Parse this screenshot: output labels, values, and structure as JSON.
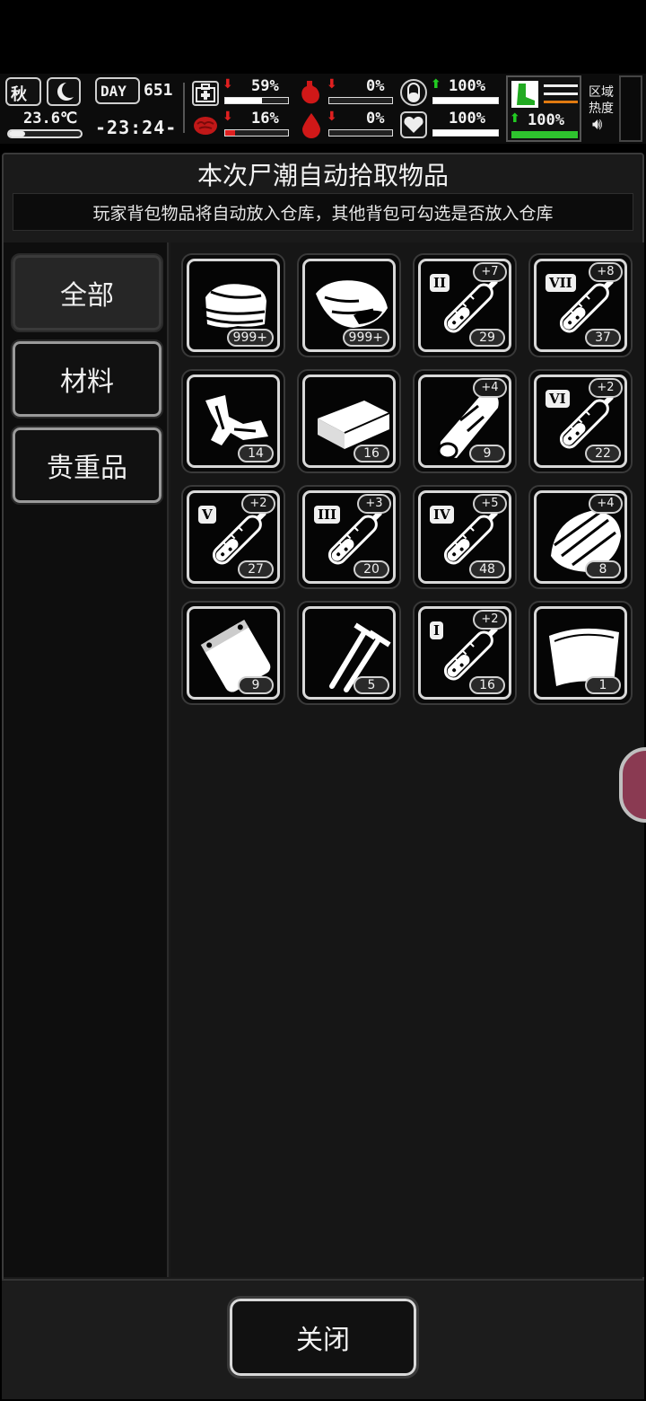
{
  "status": {
    "season": "秋",
    "temperature": "23.6℃",
    "day_label": "DAY",
    "day_number": "651",
    "time": "-23:24-",
    "stats": [
      {
        "name": "health",
        "value": "59%",
        "trend": "down",
        "level": 0.59,
        "color": "#ffffff"
      },
      {
        "name": "hunger",
        "value": "0%",
        "trend": "down",
        "level": 0.0,
        "color": "#ffffff"
      },
      {
        "name": "medicine",
        "value": "100%",
        "trend": "up",
        "level": 1.0,
        "color": "#ffffff"
      },
      {
        "name": "brain",
        "value": "16%",
        "trend": "down",
        "level": 0.16,
        "color": "#e02020"
      },
      {
        "name": "thirst",
        "value": "0%",
        "trend": "down",
        "level": 0.0,
        "color": "#ffffff"
      },
      {
        "name": "mood",
        "value": "100%",
        "trend": "none",
        "level": 1.0,
        "color": "#ffffff"
      },
      {
        "name": "stamina",
        "value": "100%",
        "trend": "up",
        "level": 1.0,
        "color": "#2ec42e"
      }
    ],
    "zone_label_1": "区域",
    "zone_label_2": "热度",
    "colors": {
      "down": "#e02020",
      "up": "#22cc22",
      "blood": "#d01818"
    }
  },
  "dialog": {
    "title": "本次尸潮自动拾取物品",
    "subtitle": "玩家背包物品将自动放入仓库，其他背包可勾选是否放入仓库",
    "close_label": "关闭"
  },
  "tabs": [
    {
      "label": "全部",
      "active": true
    },
    {
      "label": "材料",
      "active": false
    },
    {
      "label": "贵重品",
      "active": false
    }
  ],
  "items": [
    {
      "icon": "cloth-icon",
      "count": "999+",
      "plus": "",
      "roman": ""
    },
    {
      "icon": "meat-icon",
      "count": "999+",
      "plus": "",
      "roman": ""
    },
    {
      "icon": "syringe-icon",
      "count": "29",
      "plus": "+7",
      "roman": "II"
    },
    {
      "icon": "syringe-icon",
      "count": "37",
      "plus": "+8",
      "roman": "VII"
    },
    {
      "icon": "scrap-metal-icon",
      "count": "14",
      "plus": "",
      "roman": ""
    },
    {
      "icon": "brick-icon",
      "count": "16",
      "plus": "",
      "roman": ""
    },
    {
      "icon": "wood-log-icon",
      "count": "9",
      "plus": "+4",
      "roman": ""
    },
    {
      "icon": "syringe-icon",
      "count": "22",
      "plus": "+2",
      "roman": "VI"
    },
    {
      "icon": "syringe-icon",
      "count": "27",
      "plus": "+2",
      "roman": "V"
    },
    {
      "icon": "syringe-icon",
      "count": "20",
      "plus": "+3",
      "roman": "III"
    },
    {
      "icon": "syringe-icon",
      "count": "48",
      "plus": "+5",
      "roman": "IV"
    },
    {
      "icon": "leather-icon",
      "count": "8",
      "plus": "+4",
      "roman": ""
    },
    {
      "icon": "plastic-bag-icon",
      "count": "9",
      "plus": "",
      "roman": ""
    },
    {
      "icon": "nails-icon",
      "count": "5",
      "plus": "",
      "roman": ""
    },
    {
      "icon": "syringe-icon",
      "count": "16",
      "plus": "+2",
      "roman": "I"
    },
    {
      "icon": "paper-icon",
      "count": "1",
      "plus": "",
      "roman": ""
    }
  ]
}
